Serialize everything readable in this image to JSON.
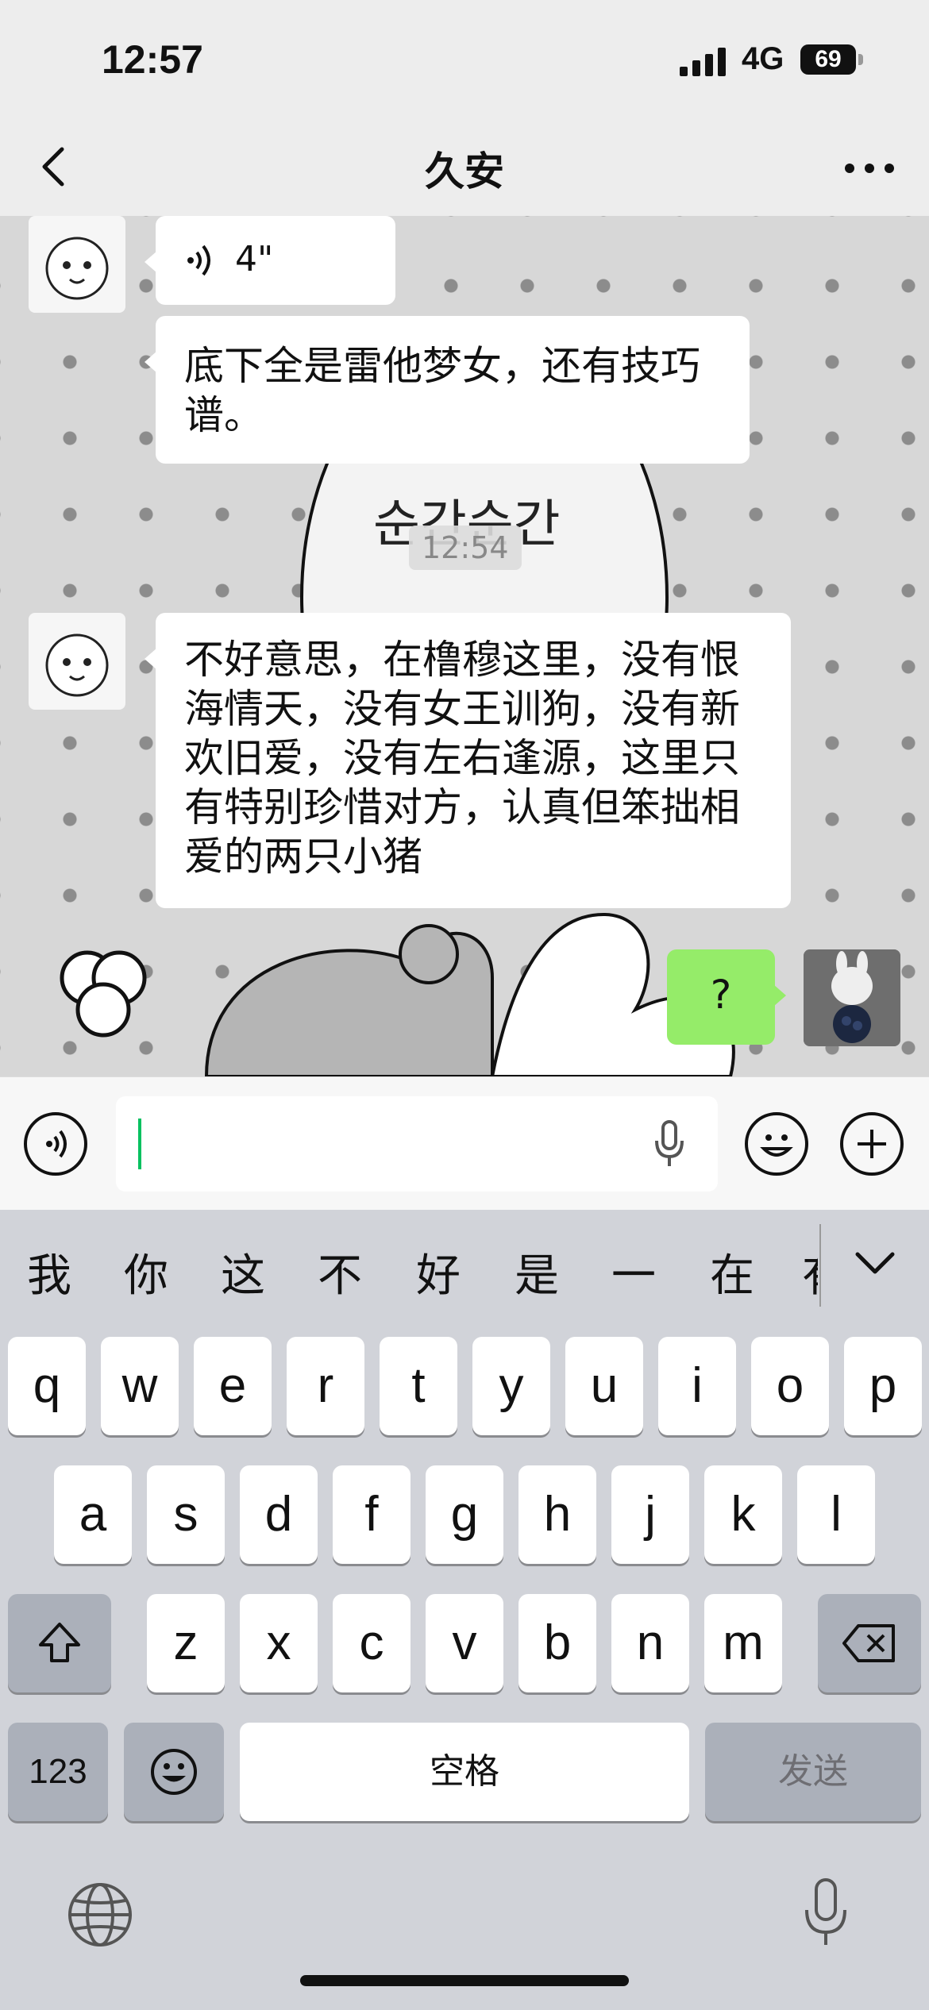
{
  "status_bar": {
    "time": "12:57",
    "network": "4G",
    "battery": "69"
  },
  "nav": {
    "title": "久安"
  },
  "messages": {
    "voice_duration": "4\"",
    "msg1": "底下全是雷他梦女，还有技巧谱。",
    "timestamp": "12:54",
    "msg2": "不好意思，在橹穆这里，没有恨海情天，没有女王训狗，没有新欢旧爱，没有左右逢源，这里只有特别珍惜对方，认真但笨拙相爱的两只小猪",
    "msg3": "?"
  },
  "keyboard": {
    "suggestions": [
      "我",
      "你",
      "这",
      "不",
      "好",
      "是",
      "一",
      "在",
      "有"
    ],
    "row1": [
      "q",
      "w",
      "e",
      "r",
      "t",
      "y",
      "u",
      "i",
      "o",
      "p"
    ],
    "row2": [
      "a",
      "s",
      "d",
      "f",
      "g",
      "h",
      "j",
      "k",
      "l"
    ],
    "row3": [
      "z",
      "x",
      "c",
      "v",
      "b",
      "n",
      "m"
    ],
    "numbers_label": "123",
    "space_label": "空格",
    "send_label": "发送"
  },
  "colors": {
    "accent_green": "#95ec69",
    "caret": "#07c160"
  }
}
